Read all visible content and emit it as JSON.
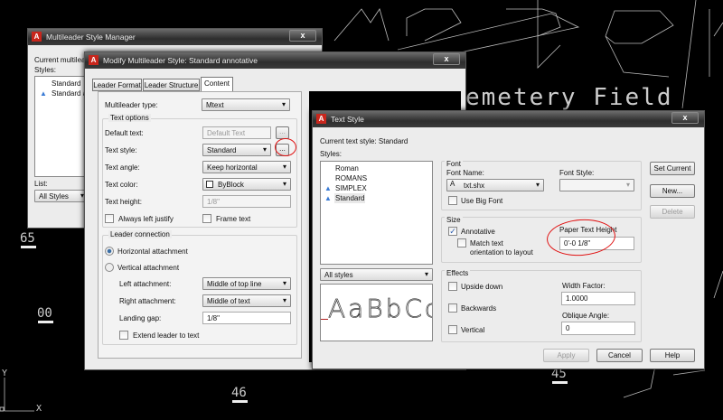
{
  "background": {
    "drawing_text": "emetery Field",
    "labels": [
      "65",
      "00",
      "46",
      "45"
    ],
    "ucs_y": "Y",
    "ucs_x": "X"
  },
  "manager": {
    "title": "Multileader Style Manager",
    "current_label": "Current multilead",
    "styles_label": "Styles:",
    "styles": [
      "Standard",
      "Standard ar"
    ],
    "list_label": "List:",
    "list_value": "All Styles"
  },
  "modify": {
    "title": "Modify Multileader Style: Standard annotative",
    "tabs": [
      "Leader Format",
      "Leader Structure",
      "Content"
    ],
    "active_tab": "Content",
    "multileader_type_label": "Multileader type:",
    "multileader_type": "Mtext",
    "text_options": "Text options",
    "default_text_label": "Default text:",
    "default_text": "Default Text",
    "text_style_label": "Text style:",
    "text_style": "Standard",
    "text_angle_label": "Text angle:",
    "text_angle": "Keep horizontal",
    "text_color_label": "Text color:",
    "text_color": "ByBlock",
    "text_height_label": "Text height:",
    "text_height": "1/8\"",
    "always_left_justify": "Always left justify",
    "frame_text": "Frame text",
    "leader_connection": "Leader connection",
    "horizontal_attachment": "Horizontal attachment",
    "vertical_attachment": "Vertical attachment",
    "left_attachment_label": "Left attachment:",
    "left_attachment": "Middle of top line",
    "right_attachment_label": "Right attachment:",
    "right_attachment": "Middle of text",
    "landing_gap_label": "Landing gap:",
    "landing_gap": "1/8\"",
    "extend_leader": "Extend leader to text",
    "browse": "..."
  },
  "textstyle": {
    "title": "Text Style",
    "current_label": "Current text style:  Standard",
    "styles_label": "Styles:",
    "styles": [
      {
        "name": "Roman",
        "annotative": false
      },
      {
        "name": "ROMANS",
        "annotative": false
      },
      {
        "name": "SIMPLEX",
        "annotative": true
      },
      {
        "name": "Standard",
        "annotative": true
      }
    ],
    "filter": "All styles",
    "preview": "AaBbCc",
    "font_group": "Font",
    "font_name_label": "Font Name:",
    "font_name": "txt.shx",
    "font_style_label": "Font Style:",
    "use_big_font": "Use Big Font",
    "size_group": "Size",
    "annotative": "Annotative",
    "annotative_checked": true,
    "match_orientation": "Match text orientation to layout",
    "paper_height_label": "Paper Text Height",
    "paper_height": "0'-0 1/8\"",
    "effects_group": "Effects",
    "upside_down": "Upside down",
    "backwards": "Backwards",
    "vertical": "Vertical",
    "width_factor_label": "Width Factor:",
    "width_factor": "1.0000",
    "oblique_label": "Oblique Angle:",
    "oblique": "0",
    "set_current": "Set Current",
    "new": "New...",
    "delete": "Delete",
    "apply": "Apply",
    "cancel": "Cancel",
    "help": "Help"
  },
  "colors": {
    "annotation_circle": "#e01010",
    "autocad_red": "#c8261c"
  }
}
